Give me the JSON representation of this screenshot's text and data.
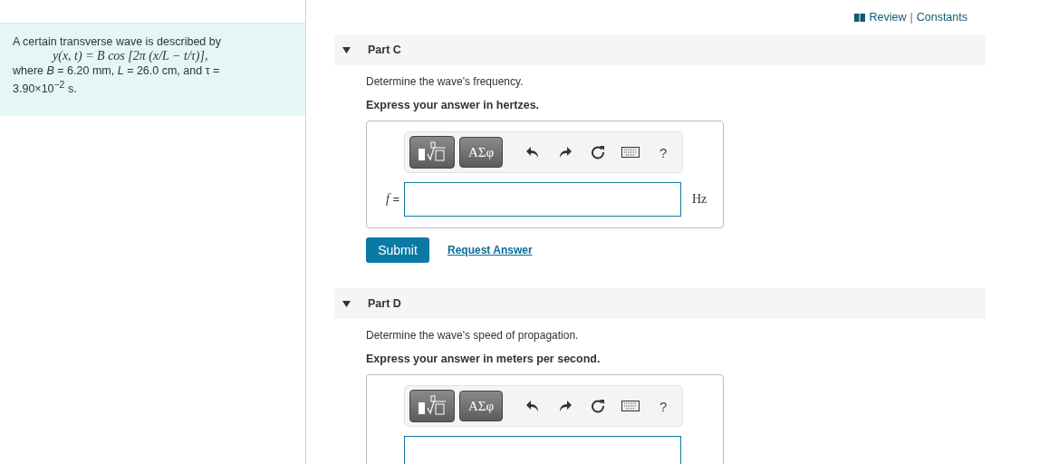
{
  "problem": {
    "intro": "A certain transverse wave is described by",
    "formula": "y(x, t) = B cos [2π (x/L − t/τ)],",
    "conditions": "where *B* = 6.20 mm, *L* = 26.0 cm, and τ = 3.90×10$^{−2}$ s."
  },
  "links": {
    "review": "Review",
    "separator": "|",
    "constants": "Constants"
  },
  "parts": [
    {
      "title": "Part C",
      "expanded": true,
      "question": "Determine the wave's frequency.",
      "instruction": "Express your answer in hertzes.",
      "toolbar": {
        "symbols": "ΑΣφ",
        "help": "?"
      },
      "variable": "f",
      "equals": "=",
      "unit": "Hz",
      "submit": "Submit",
      "request": "Request Answer"
    },
    {
      "title": "Part D",
      "expanded": true,
      "question": "Determine the wave's speed of propagation.",
      "instruction": "Express your answer in meters per second.",
      "toolbar": {
        "symbols": "ΑΣφ",
        "help": "?"
      }
    }
  ]
}
